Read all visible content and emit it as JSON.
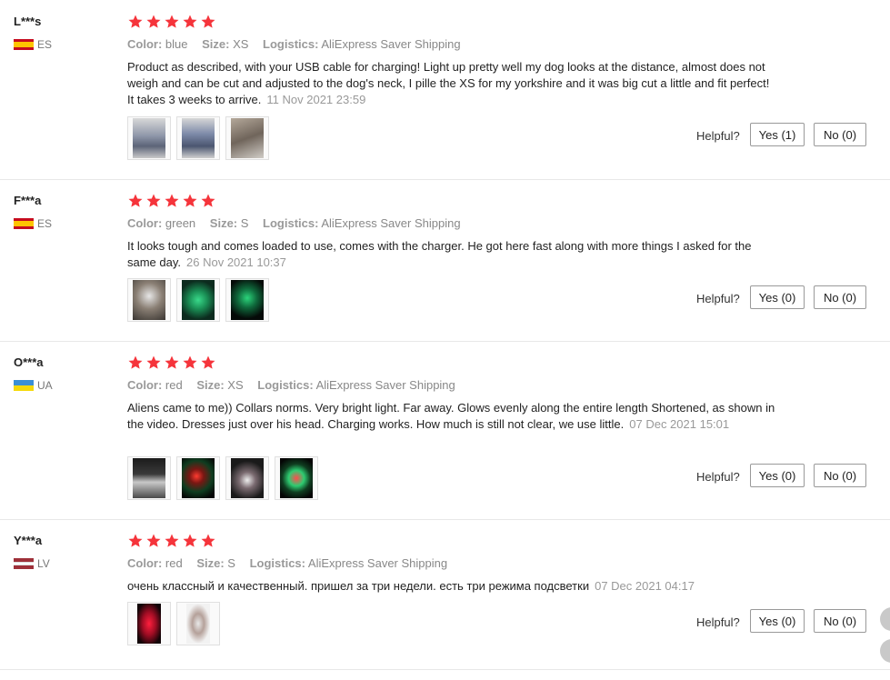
{
  "colors": {
    "star": "#f5343b",
    "accent": "#f5343b"
  },
  "labels": {
    "color": "Color:",
    "size": "Size:",
    "logistics": "Logistics:",
    "helpful": "Helpful?"
  },
  "reviews": [
    {
      "user": "L***s",
      "country": "ES",
      "flag": [
        "#c60b1e",
        "#ffc400",
        "#c60b1e"
      ],
      "rating": 5,
      "color": "blue",
      "size": "XS",
      "logistics": "AliExpress Saver Shipping",
      "text": "Product as described, with your USB cable for charging! Light up pretty well my dog looks at the distance, almost does not weigh and can be cut and adjusted to the dog's neck, I pille the XS for my yorkshire and it was big cut a little and fit perfect! It takes 3 weeks to arrive.",
      "date": "11 Nov 2021 23:59",
      "images": [
        "photo-1",
        "photo-2",
        "photo-3"
      ],
      "yes": "Yes (1)",
      "no": "No (0)"
    },
    {
      "user": "F***a",
      "country": "ES",
      "flag": [
        "#c60b1e",
        "#ffc400",
        "#c60b1e"
      ],
      "rating": 5,
      "color": "green",
      "size": "S",
      "logistics": "AliExpress Saver Shipping",
      "text": "It looks tough and comes loaded to use, comes with the charger. He got here fast along with more things I asked for the same day.",
      "date": "26 Nov 2021 10:37",
      "images": [
        "photo-1",
        "photo-2",
        "photo-3"
      ],
      "yes": "Yes (0)",
      "no": "No (0)"
    },
    {
      "user": "O***a",
      "country": "UA",
      "flag": [
        "#3a8fd6",
        "#f5d90a"
      ],
      "rating": 5,
      "color": "red",
      "size": "XS",
      "logistics": "AliExpress Saver Shipping",
      "text": "Aliens came to me)) Collars norms. Very bright light. Far away. Glows evenly along the entire length Shortened, as shown in the video. Dresses just over his head. Charging works. How much is still not clear, we use little.",
      "date": "07 Dec 2021 15:01",
      "images": [
        "photo-1",
        "photo-2",
        "photo-3",
        "photo-4"
      ],
      "yes": "Yes (0)",
      "no": "No (0)"
    },
    {
      "user": "Y***a",
      "country": "LV",
      "flag": [
        "#9e3039",
        "#ffffff",
        "#9e3039"
      ],
      "rating": 5,
      "color": "red",
      "size": "S",
      "logistics": "AliExpress Saver Shipping",
      "text": "очень классный и качественный. пришел за три недели. есть три режима подсветки",
      "date": "07 Dec 2021 04:17",
      "images": [
        "photo-1",
        "photo-2"
      ],
      "yes": "Yes (0)",
      "no": "No (0)"
    }
  ]
}
